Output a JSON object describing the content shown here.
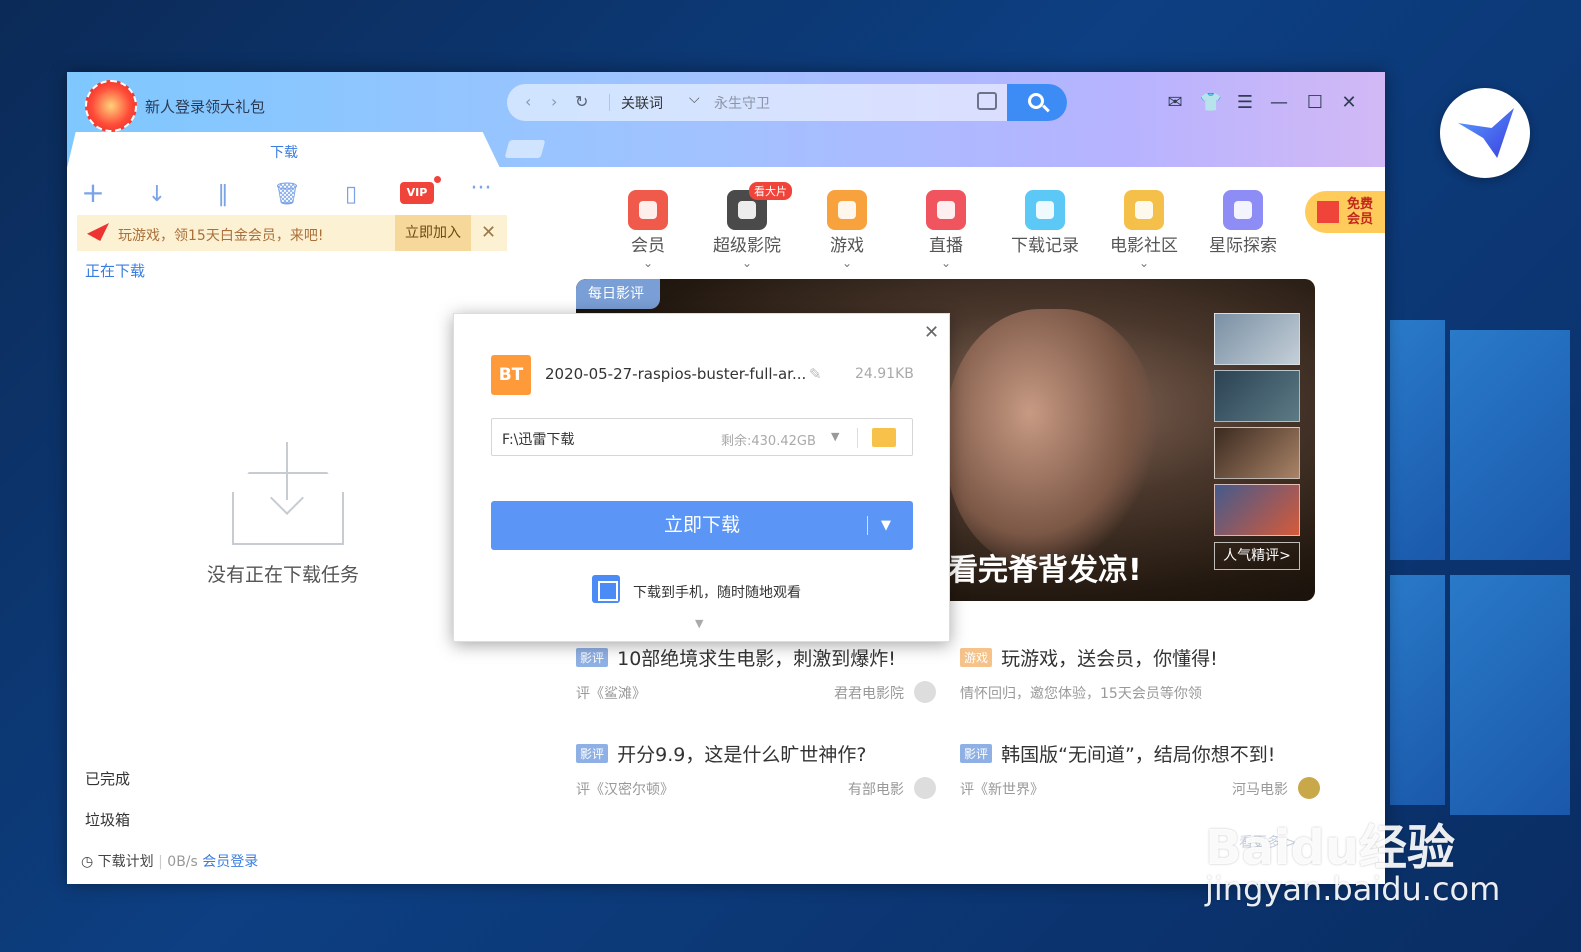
{
  "titlebar": {
    "gift_text": "新人登录领大礼包",
    "keyword_label": "关联词",
    "search_placeholder": "永生守卫"
  },
  "tabs": {
    "active": "下载"
  },
  "banner": {
    "text": "玩游戏，领15天白金会员，来吧!",
    "join_label": "立即加入",
    "close_label": "✕"
  },
  "left": {
    "downloading": "正在下载",
    "empty_text": "没有正在下载任务",
    "completed": "已完成",
    "trash": "垃圾箱",
    "plan": "下载计划",
    "speed": "0B/s",
    "login": "会员登录",
    "vip_label": "VIP"
  },
  "categories": [
    {
      "label": "会员",
      "color": "#f05a4a"
    },
    {
      "label": "超级影院",
      "color": "#4a4a4a"
    },
    {
      "label": "游戏",
      "color": "#f7a23c"
    },
    {
      "label": "直播",
      "color": "#f0555f"
    },
    {
      "label": "下载记录",
      "color": "#5cc8f5"
    },
    {
      "label": "电影社区",
      "color": "#f5c04a"
    },
    {
      "label": "星际探索",
      "color": "#8e8cf5"
    }
  ],
  "hot_badge": "看大片",
  "free_member": "免费会员",
  "hero": {
    "tag": "每日影评",
    "caption": "看完脊背发凉!",
    "more": "人气精评>"
  },
  "articles": [
    {
      "tag": "影评",
      "title": "10部绝境求生电影，刺激到爆炸!",
      "sub": "评《鲨滩》",
      "source": "君君电影院"
    },
    {
      "tag": "游戏",
      "title": "玩游戏，送会员，你懂得!",
      "sub": "情怀回归，邀您体验，15天会员等你领",
      "source": ""
    },
    {
      "tag": "影评",
      "title": "开分9.9，这是什么旷世神作?",
      "sub": "评《汉密尔顿》",
      "source": "有部电影"
    },
    {
      "tag": "影评",
      "title": "韩国版“无间道”，结局你想不到!",
      "sub": "评《新世界》",
      "source": "河马电影"
    }
  ],
  "dialog": {
    "file_badge": "BT",
    "file_name": "2020-05-27-raspios-buster-full-ar...",
    "file_size": "24.91KB",
    "path": "F:\\迅雷下载",
    "free_space": "剩余:430.42GB",
    "download_btn": "立即下载",
    "phone_text": "下载到手机，随时随地观看"
  },
  "colors": {
    "accent": "#3d8cf5",
    "download_btn": "#5b95f5",
    "banner_bg": "#fdf1d4"
  },
  "watermark": {
    "brand": "Baidu经验",
    "url": "jingyan.baidu.com",
    "faded_link": "看更多 >"
  }
}
